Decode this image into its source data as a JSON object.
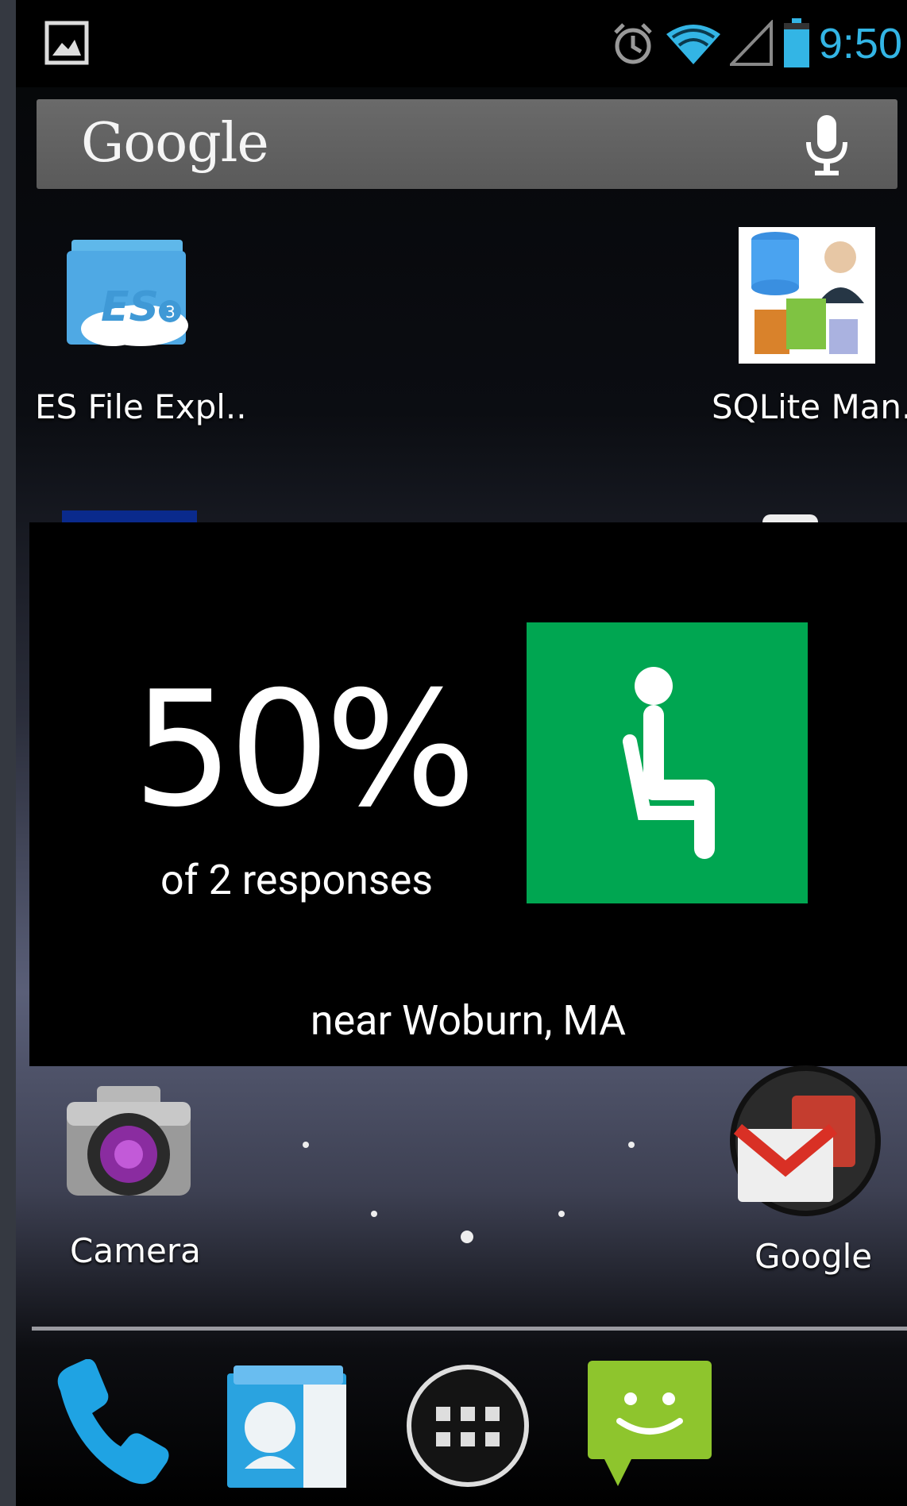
{
  "status_bar": {
    "time": "9:50",
    "icons": [
      "image-notification-icon",
      "alarm-icon",
      "wifi-icon",
      "signal-icon",
      "battery-icon"
    ]
  },
  "search": {
    "logo_text": "Google",
    "mic_icon": "microphone-icon"
  },
  "apps_top": [
    {
      "label": "ES File Expl..",
      "icon": "es-file-explorer-icon"
    },
    {
      "label": "SQLite Man..",
      "icon": "sqlite-manager-icon"
    }
  ],
  "widget": {
    "percent": "50%",
    "responses": "of 2 responses",
    "location": "near Woburn, MA",
    "tile_color": "#00a651",
    "tile_icon": "seated-person-icon"
  },
  "apps_bottom": [
    {
      "label": "Camera",
      "icon": "camera-icon"
    },
    {
      "label": "Google",
      "icon": "google-folder-icon"
    }
  ],
  "dock": [
    {
      "icon": "phone-icon"
    },
    {
      "icon": "contacts-icon"
    },
    {
      "icon": "app-drawer-icon"
    },
    {
      "icon": "messaging-icon"
    }
  ],
  "colors": {
    "accent": "#33b5e5",
    "status_bar": "#000000",
    "widget_bg": "#000000"
  }
}
